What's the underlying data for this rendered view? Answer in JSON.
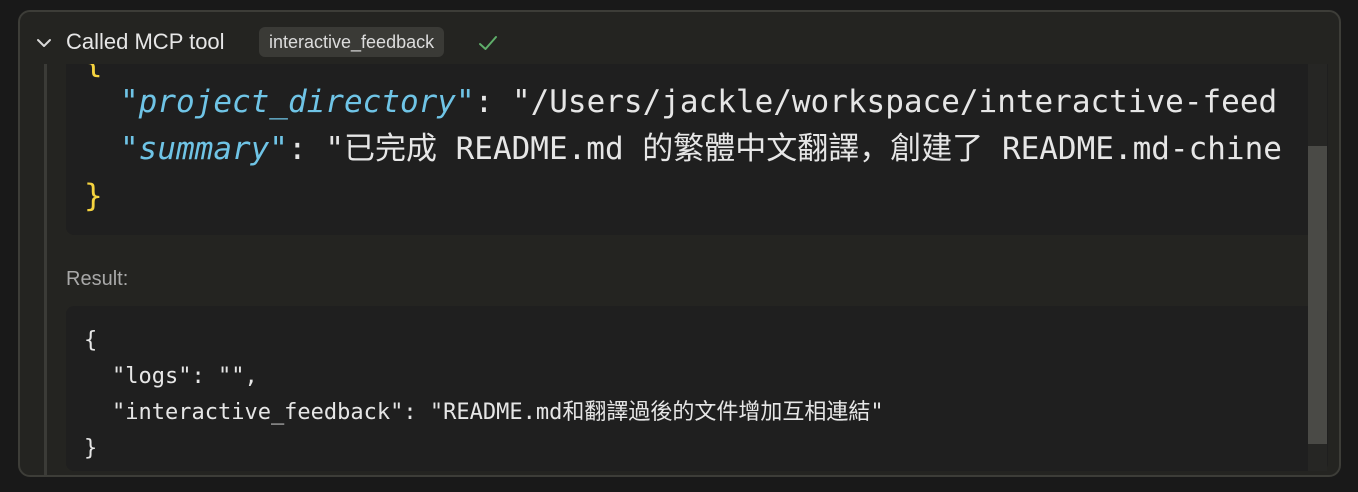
{
  "header": {
    "title": "Called MCP tool",
    "tool_name": "interactive_feedback",
    "status": "completed"
  },
  "arguments": {
    "open_brace": "{",
    "close_brace": "}",
    "lines": [
      {
        "key": "\"project_directory\"",
        "value": "\"/Users/jackle/workspace/interactive-feed"
      },
      {
        "key": "\"summary\"",
        "value": "\"已完成 README.md 的繁體中文翻譯，創建了 README.md-chine"
      }
    ]
  },
  "result": {
    "label": "Result:",
    "lines": [
      "{",
      "\"logs\": \"\",",
      "\"interactive_feedback\": \"README.md和翻譯過後的文件增加互相連結\"",
      "}"
    ]
  },
  "colors": {
    "brace": "#f5d33f",
    "key": "#6fc4e6",
    "check": "#5fae6a"
  },
  "icons": {
    "collapse": "chevron-down-icon",
    "status": "check-icon"
  },
  "scroll": {
    "visible_fraction": 0.73,
    "offset_fraction": 0.2
  }
}
